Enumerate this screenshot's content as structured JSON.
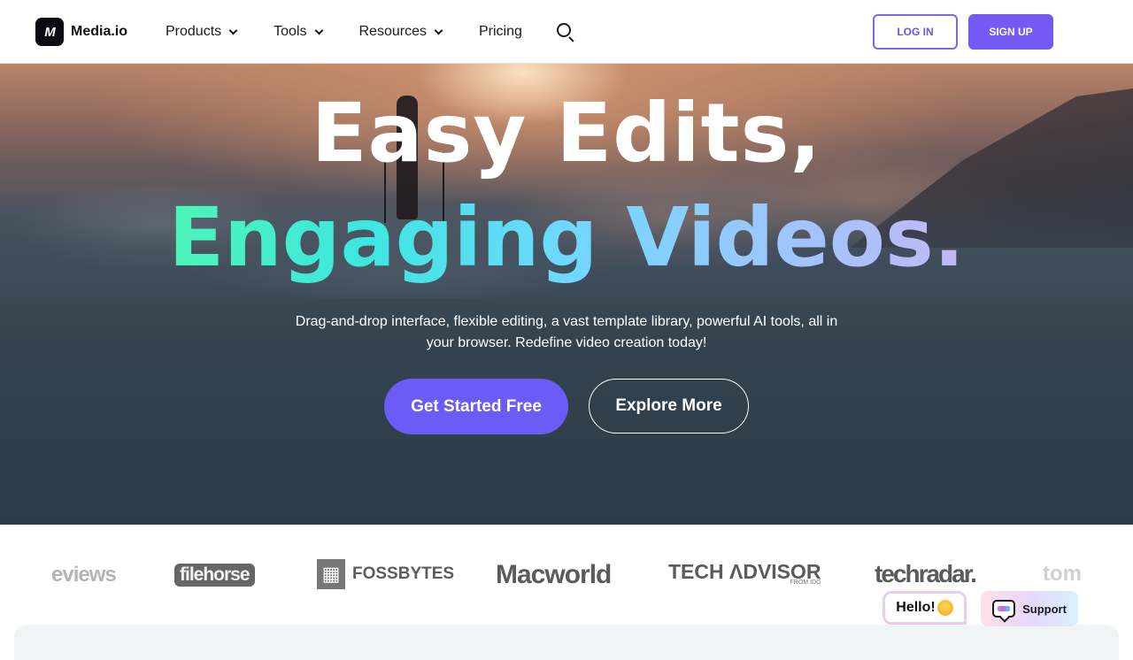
{
  "header": {
    "brand": "Media.io",
    "logo_mark": "M",
    "nav": [
      {
        "label": "Products",
        "has_dropdown": true
      },
      {
        "label": "Tools",
        "has_dropdown": true
      },
      {
        "label": "Resources",
        "has_dropdown": true
      },
      {
        "label": "Pricing",
        "has_dropdown": false
      }
    ],
    "search_icon": "search-icon",
    "login_label": "LOG IN",
    "signup_label": "SIGN UP"
  },
  "hero": {
    "headline_line1": "Easy Edits,",
    "headline_line2": "Engaging Videos.",
    "subtitle": "Drag-and-drop interface, flexible editing, a vast template library, powerful AI tools, all in your browser. Redefine video creation today!",
    "primary_cta": "Get Started Free",
    "secondary_cta": "Explore More"
  },
  "press_logos": [
    {
      "name": "reviews",
      "text": "eviews"
    },
    {
      "name": "filehorse",
      "text": "filehorse"
    },
    {
      "name": "fossbytes",
      "text": "FOSSBYTES"
    },
    {
      "name": "macworld",
      "text": "Macworld"
    },
    {
      "name": "tech-advisor",
      "text": "TECH ΛDVISOR",
      "subtext": "FROM IDG"
    },
    {
      "name": "techradar",
      "text": "techradar."
    },
    {
      "name": "toms",
      "text": "tom"
    }
  ],
  "widgets": {
    "hello_label": "Hello!",
    "support_label": "Support"
  },
  "colors": {
    "brand_purple": "#7459f5",
    "cta_purple": "#6b5cf5",
    "gradient_start": "#4df5b8",
    "gradient_end": "#c2b8f5"
  }
}
